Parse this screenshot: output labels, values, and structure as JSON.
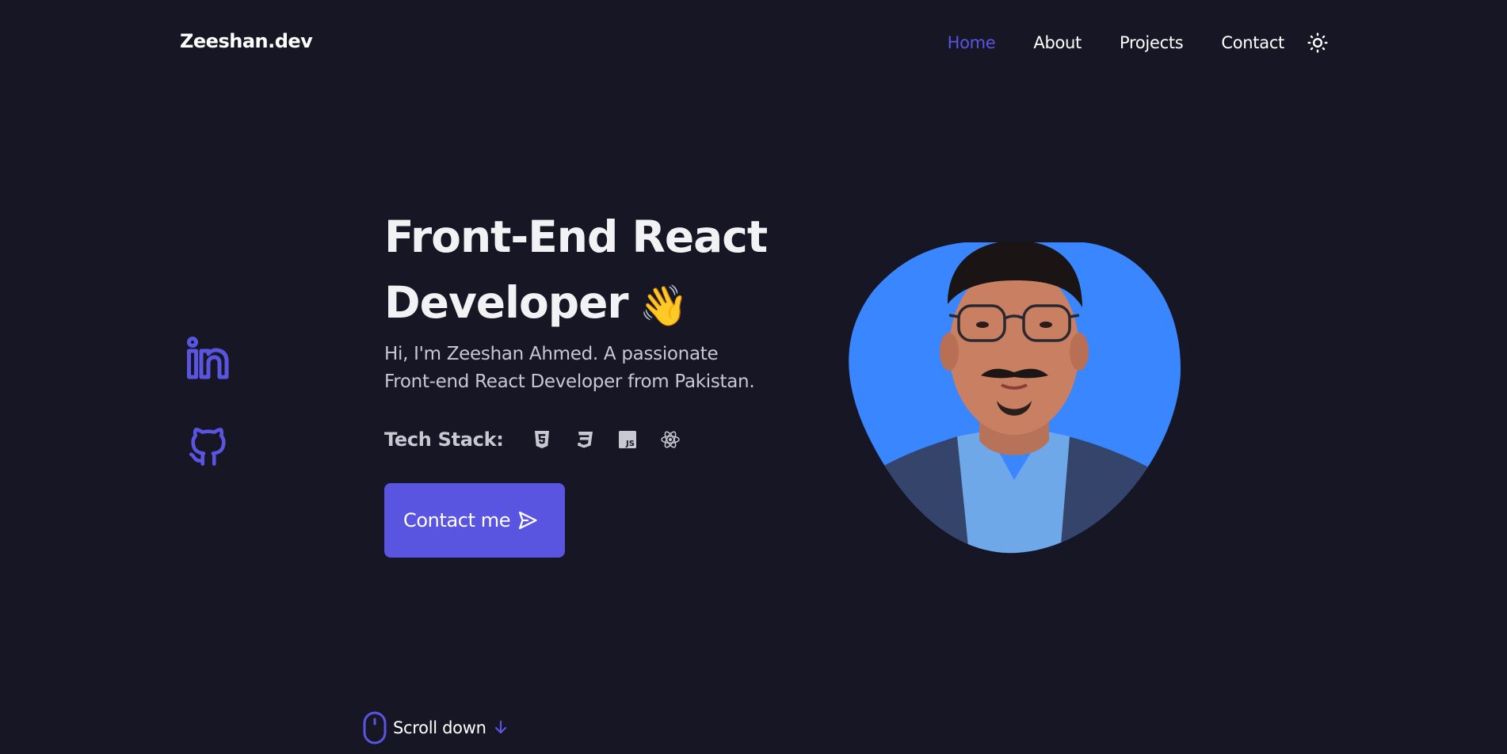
{
  "header": {
    "logo": "Zeeshan.dev",
    "nav": {
      "home": "Home",
      "about": "About",
      "projects": "Projects",
      "contact": "Contact"
    },
    "theme_icon": "sun-icon"
  },
  "socials": [
    {
      "icon": "linkedin-icon"
    },
    {
      "icon": "github-icon"
    }
  ],
  "hero": {
    "title_line1": "Front-End React",
    "title_line2": "Developer",
    "wave_emoji": "👋",
    "description": "Hi, I'm Zeeshan Ahmed. A passionate Front-end React Developer from Pakistan.",
    "tech_label": "Tech Stack:",
    "tech_icons": [
      "html5-icon",
      "css3-icon",
      "javascript-icon",
      "react-icon"
    ],
    "cta_label": "Contact me"
  },
  "scroll": {
    "label": "Scroll down"
  },
  "colors": {
    "background": "#161625",
    "accent": "#5a55e0",
    "portrait_bg": "#3a86ff"
  }
}
